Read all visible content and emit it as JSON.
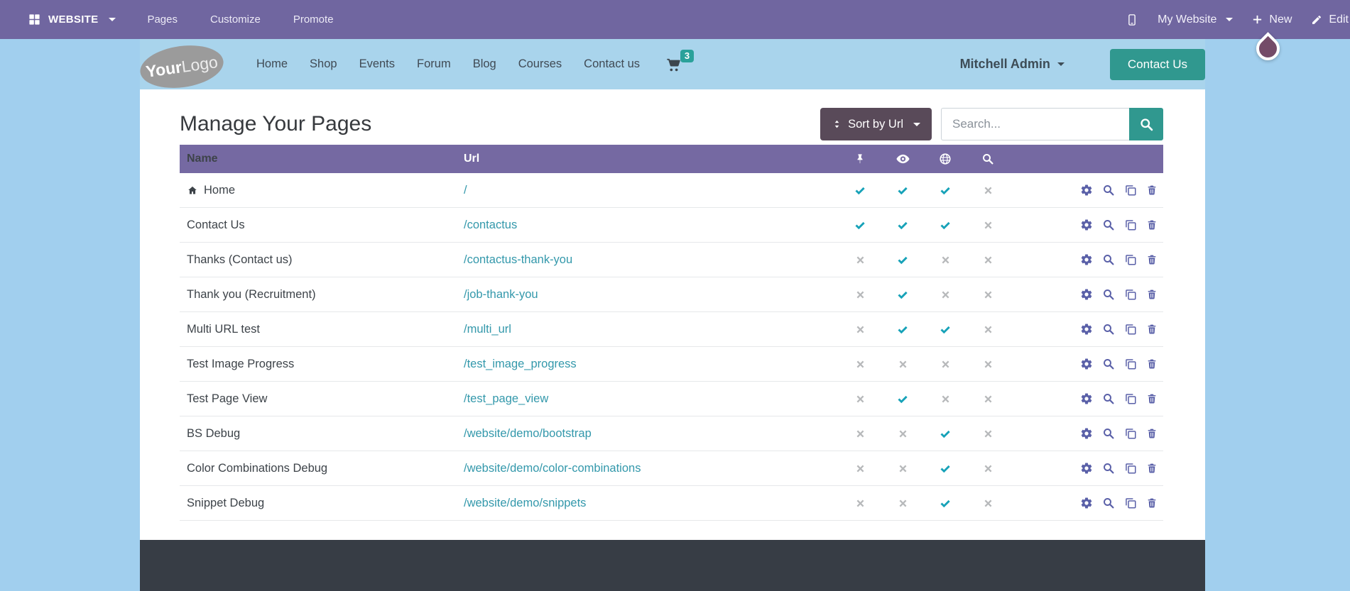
{
  "topbar": {
    "apps_menu": {
      "label": "WEBSITE",
      "icon": "grid-icon"
    },
    "menu_items": [
      {
        "label": "Pages"
      },
      {
        "label": "Customize"
      },
      {
        "label": "Promote"
      }
    ],
    "right": {
      "mobile_preview_icon": "mobile-icon",
      "website_switcher": "My Website",
      "new_button": "New",
      "edit_button": "Edit"
    }
  },
  "site_header": {
    "logo_text_bold": "Your",
    "logo_text_light": "Logo",
    "nav_items": [
      {
        "label": "Home"
      },
      {
        "label": "Shop"
      },
      {
        "label": "Events"
      },
      {
        "label": "Forum"
      },
      {
        "label": "Blog"
      },
      {
        "label": "Courses"
      },
      {
        "label": "Contact us"
      }
    ],
    "cart": {
      "icon": "cart-icon",
      "count": "3"
    },
    "user_menu_label": "Mitchell Admin",
    "contact_button_label": "Contact Us"
  },
  "page": {
    "title": "Manage Your Pages",
    "sort_button_label": "Sort by Url",
    "search_placeholder": "Search..."
  },
  "table": {
    "name_header": "Name",
    "url_header": "Url",
    "status_columns": [
      "pin-icon",
      "eye-icon",
      "globe-icon",
      "search-icon"
    ],
    "row_actions": [
      "gear-icon",
      "search-icon",
      "copy-icon",
      "trash-icon"
    ],
    "rows": [
      {
        "name": "Home",
        "icon": "home-icon",
        "url": "/",
        "status": [
          true,
          true,
          true,
          false
        ]
      },
      {
        "name": "Contact Us",
        "url": "/contactus",
        "status": [
          true,
          true,
          true,
          false
        ]
      },
      {
        "name": "Thanks (Contact us)",
        "url": "/contactus-thank-you",
        "status": [
          false,
          true,
          false,
          false
        ]
      },
      {
        "name": "Thank you (Recruitment)",
        "url": "/job-thank-you",
        "status": [
          false,
          true,
          false,
          false
        ]
      },
      {
        "name": "Multi URL test",
        "url": "/multi_url",
        "status": [
          false,
          true,
          true,
          false
        ]
      },
      {
        "name": "Test Image Progress",
        "url": "/test_image_progress",
        "status": [
          false,
          false,
          false,
          false
        ]
      },
      {
        "name": "Test Page View",
        "url": "/test_page_view",
        "status": [
          false,
          true,
          false,
          false
        ]
      },
      {
        "name": "BS Debug",
        "url": "/website/demo/bootstrap",
        "status": [
          false,
          false,
          true,
          false
        ]
      },
      {
        "name": "Color Combinations Debug",
        "url": "/website/demo/color-combinations",
        "status": [
          false,
          false,
          true,
          false
        ]
      },
      {
        "name": "Snippet Debug",
        "url": "/website/demo/snippets",
        "status": [
          false,
          false,
          true,
          false
        ]
      }
    ]
  },
  "colors": {
    "topbar_purple": "#7066a0",
    "table_header_purple": "#7569a2",
    "page_blue": "#a1cfee",
    "header_strip_blue": "#a9d4ec",
    "teal_button": "#30988f",
    "link_teal": "#3398ab",
    "check_teal": "#17a2b8",
    "cross_gray": "#b7b9bb",
    "action_icon_purple": "#5a60a8",
    "sort_button_bg": "#594a59",
    "footer_dark": "#373d45",
    "drop_indicator": "#744b68",
    "cart_icon_dark": "#3d464d"
  }
}
